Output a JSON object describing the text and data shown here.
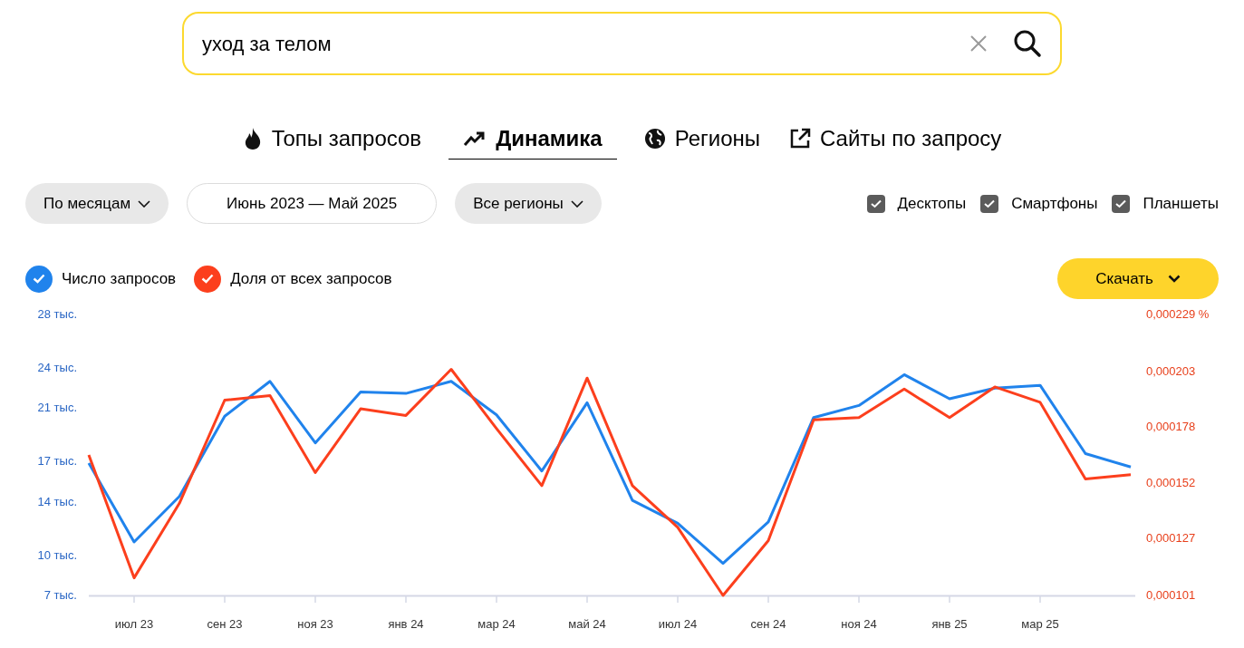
{
  "search": {
    "value": "уход за телом"
  },
  "tabs": [
    {
      "label": "Топы запросов",
      "kind": "fire",
      "selected": false
    },
    {
      "label": "Динамика",
      "kind": "trend",
      "selected": true
    },
    {
      "label": "Регионы",
      "kind": "globe",
      "selected": false
    },
    {
      "label": "Сайты по запросу",
      "kind": "external",
      "selected": false
    }
  ],
  "filters": [
    {
      "label": "По месяцам",
      "kind": "dropdown"
    },
    {
      "label": "Июнь 2023 — Май 2025",
      "kind": "range"
    },
    {
      "label": "Все регионы",
      "kind": "dropdown"
    }
  ],
  "devices": [
    {
      "label": "Десктопы",
      "checked": true
    },
    {
      "label": "Смартфоны",
      "checked": true
    },
    {
      "label": "Планшеты",
      "checked": true
    }
  ],
  "legend": [
    {
      "checked": true
    },
    {
      "checked": true
    }
  ],
  "download_button": {
    "label": "Скачать"
  },
  "chart_data": {
    "type": "line",
    "categories": [
      null,
      "июл 23",
      null,
      "сен 23",
      null,
      "ноя 23",
      null,
      "янв 24",
      null,
      "мар 24",
      null,
      "май 24",
      null,
      "июл 24",
      null,
      "сен 24",
      null,
      "ноя 24",
      null,
      "янв 25",
      null,
      "мар 25",
      null,
      null
    ],
    "ylim": [
      7,
      28
    ],
    "yticks": [
      {
        "value": 7,
        "label": "7 тыс."
      },
      {
        "value": 10,
        "label": "10 тыс."
      },
      {
        "value": 14,
        "label": "14 тыс."
      },
      {
        "value": 17,
        "label": "17 тыс."
      },
      {
        "value": 21,
        "label": "21 тыс."
      },
      {
        "value": 24,
        "label": "24 тыс."
      },
      {
        "value": 28,
        "label": "28 тыс."
      }
    ],
    "y2lim": [
      0.000101,
      0.000229
    ],
    "y2ticks": [
      {
        "value": 0.000101,
        "label": "0,000101"
      },
      {
        "value": 0.000127,
        "label": "0,000127"
      },
      {
        "value": 0.000152,
        "label": "0,000152"
      },
      {
        "value": 0.000178,
        "label": "0,000178"
      },
      {
        "value": 0.000203,
        "label": "0,000203"
      },
      {
        "value": 0.000229,
        "label": "0,000229 %"
      }
    ],
    "series": [
      {
        "name": "Число запросов",
        "color": "#2083ec",
        "values": [
          16.9,
          11.0,
          14.4,
          20.4,
          23.0,
          18.4,
          22.2,
          22.1,
          23.0,
          20.5,
          16.3,
          21.4,
          14.1,
          12.4,
          9.4,
          12.5,
          20.3,
          21.2,
          23.5,
          21.7,
          22.5,
          22.7,
          17.6,
          16.6
        ]
      },
      {
        "name": "Доля от всех запросов",
        "color": "#fc3f1d",
        "axis": "y2",
        "values": [
          0.000165,
          0.000109,
          0.000143,
          0.00019,
          0.000192,
          0.000157,
          0.000186,
          0.000183,
          0.000204,
          0.000177,
          0.000151,
          0.0002,
          0.000151,
          0.000132,
          0.000101,
          0.000126,
          0.000181,
          0.000182,
          0.000195,
          0.000182,
          0.000196,
          0.000189,
          0.000154,
          0.000156
        ]
      }
    ]
  }
}
